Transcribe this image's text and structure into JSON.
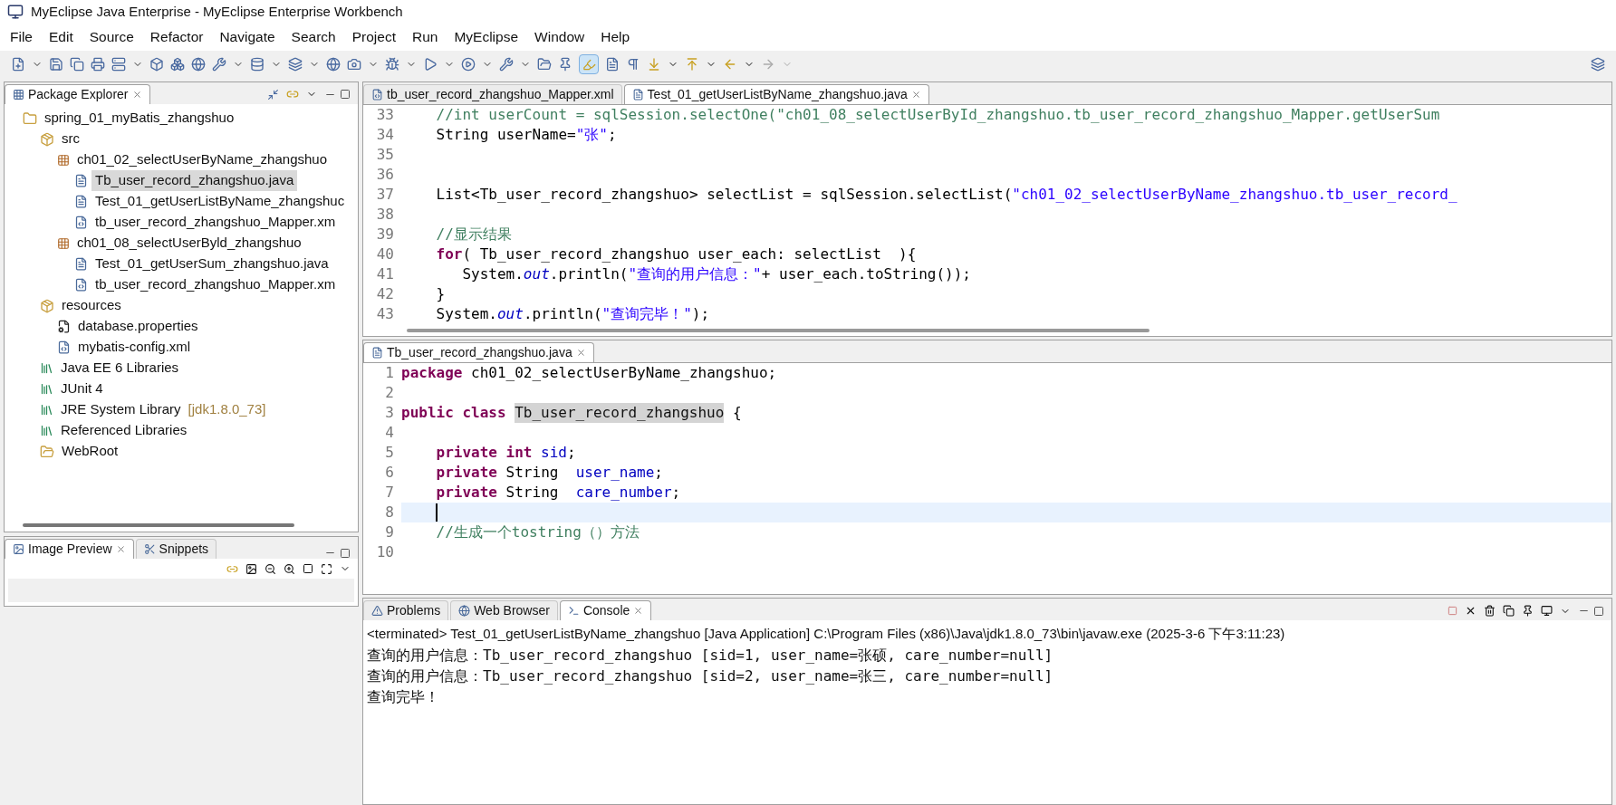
{
  "window": {
    "title": "MyEclipse Java Enterprise - MyEclipse Enterprise Workbench"
  },
  "menu": [
    "File",
    "Edit",
    "Source",
    "Refactor",
    "Navigate",
    "Search",
    "Project",
    "Run",
    "MyEclipse",
    "Window",
    "Help"
  ],
  "toolbar": {
    "highlight_toggle": {
      "pressed": true
    }
  },
  "package_explorer": {
    "tab": {
      "label": "Package Explorer",
      "selected": true
    },
    "tree": [
      {
        "label": "spring_01_myBatis_zhangshuo",
        "kind": "project",
        "selected": false,
        "children": [
          {
            "label": "src",
            "kind": "sourcefolder",
            "selected": false,
            "children": [
              {
                "label": "ch01_02_selectUserByName_zhangshuo",
                "kind": "package",
                "selected": false,
                "children": [
                  {
                    "label": "Tb_user_record_zhangshuo.java",
                    "kind": "java",
                    "selected": true
                  },
                  {
                    "label": "Test_01_getUserListByName_zhangshuc",
                    "kind": "java",
                    "selected": false
                  },
                  {
                    "label": "tb_user_record_zhangshuo_Mapper.xm",
                    "kind": "xml",
                    "selected": false
                  }
                ]
              },
              {
                "label": "ch01_08_selectUserByld_zhangshuo",
                "kind": "package",
                "selected": false,
                "children": [
                  {
                    "label": "Test_01_getUserSum_zhangshuo.java",
                    "kind": "java",
                    "selected": false
                  },
                  {
                    "label": "tb_user_record_zhangshuo_Mapper.xm",
                    "kind": "xml",
                    "selected": false
                  }
                ]
              }
            ]
          },
          {
            "label": "resources",
            "kind": "sourcefolder",
            "selected": false,
            "children": [
              {
                "label": "database.properties",
                "kind": "properties",
                "selected": false
              },
              {
                "label": "mybatis-config.xml",
                "kind": "xml",
                "selected": false
              }
            ]
          },
          {
            "label": "Java EE 6 Libraries",
            "kind": "library",
            "selected": false
          },
          {
            "label": "JUnit 4",
            "kind": "library",
            "selected": false
          },
          {
            "label": "JRE System Library",
            "decoration": "[jdk1.8.0_73]",
            "kind": "library",
            "selected": false
          },
          {
            "label": "Referenced Libraries",
            "kind": "library",
            "selected": false
          },
          {
            "label": "WebRoot",
            "kind": "folder",
            "selected": false
          }
        ]
      }
    ]
  },
  "preview_panel": {
    "tabs": [
      {
        "label": "Image Preview",
        "selected": true
      },
      {
        "label": "Snippets",
        "selected": false
      }
    ]
  },
  "editor_top": {
    "tabs": [
      {
        "label": "tb_user_record_zhangshuo_Mapper.xml",
        "kind": "xml",
        "selected": false
      },
      {
        "label": "Test_01_getUserListByName_zhangshuo.java",
        "kind": "java",
        "selected": true
      }
    ],
    "lines": [
      {
        "number": "33",
        "current": false,
        "tokens": [
          {
            "kind": "comment",
            "text": "    //int userCount = sqlSession.selectOne(\"ch01_08_selectUserById_zhangshuo.tb_user_record_zhangshuo_Mapper.getUserSum"
          }
        ]
      },
      {
        "number": "34",
        "current": false,
        "tokens": [
          {
            "kind": "plain",
            "text": "    String userName="
          },
          {
            "kind": "string",
            "text": "\"张\""
          },
          {
            "kind": "plain",
            "text": ";"
          }
        ]
      },
      {
        "number": "35",
        "current": false
      },
      {
        "number": "36",
        "current": false
      },
      {
        "number": "37",
        "current": false,
        "tokens": [
          {
            "kind": "plain",
            "text": "    List<Tb_user_record_zhangshuo> selectList = sqlSession.selectList("
          },
          {
            "kind": "string",
            "text": "\"ch01_02_selectUserByName_zhangshuo.tb_user_record_"
          }
        ]
      },
      {
        "number": "38",
        "current": false
      },
      {
        "number": "39",
        "current": false,
        "tokens": [
          {
            "kind": "comment",
            "text": "    //显示结果"
          }
        ]
      },
      {
        "number": "40",
        "current": false,
        "tokens": [
          {
            "kind": "keyword",
            "text": "    for"
          },
          {
            "kind": "plain",
            "text": "( Tb_user_record_zhangshuo user_each: selectList  ){"
          }
        ]
      },
      {
        "number": "41",
        "current": false,
        "tokens": [
          {
            "kind": "plain",
            "text": "       System."
          },
          {
            "kind": "static",
            "text": "out"
          },
          {
            "kind": "plain",
            "text": ".println("
          },
          {
            "kind": "string",
            "text": "\"查询的用户信息：\""
          },
          {
            "kind": "plain",
            "text": "+ user_each.toString());"
          }
        ]
      },
      {
        "number": "42",
        "current": false,
        "tokens": [
          {
            "kind": "plain",
            "text": "    }"
          }
        ]
      },
      {
        "number": "43",
        "current": false,
        "tokens": [
          {
            "kind": "plain",
            "text": "    System."
          },
          {
            "kind": "static",
            "text": "out"
          },
          {
            "kind": "plain",
            "text": ".println("
          },
          {
            "kind": "string",
            "text": "\"查询完毕！\""
          },
          {
            "kind": "plain",
            "text": ");"
          }
        ]
      }
    ]
  },
  "editor_bottom": {
    "tabs": [
      {
        "label": "Tb_user_record_zhangshuo.java",
        "kind": "java",
        "selected": true
      }
    ],
    "lines": [
      {
        "number": "1",
        "current": false,
        "tokens": [
          {
            "kind": "keyword",
            "text": "package"
          },
          {
            "kind": "plain",
            "text": " ch01_02_selectUserByName_zhangshuo;"
          }
        ]
      },
      {
        "number": "2",
        "current": false
      },
      {
        "number": "3",
        "current": false,
        "tokens": [
          {
            "kind": "keyword",
            "text": "public class"
          },
          {
            "kind": "occurrence",
            "text": "Tb_user_record_zhangshuo"
          },
          {
            "kind": "plain",
            "text": " {"
          }
        ]
      },
      {
        "number": "4",
        "current": false
      },
      {
        "number": "5",
        "current": false,
        "tokens": [
          {
            "kind": "keyword",
            "text": "    private int"
          },
          {
            "kind": "field",
            "text": "sid"
          },
          {
            "kind": "plain",
            "text": ";"
          }
        ]
      },
      {
        "number": "6",
        "current": false,
        "tokens": [
          {
            "kind": "keyword",
            "text": "    private"
          },
          {
            "kind": "plain",
            "text": " String "
          },
          {
            "kind": "field",
            "text": "user_name"
          },
          {
            "kind": "plain",
            "text": ";"
          }
        ]
      },
      {
        "number": "7",
        "current": false,
        "tokens": [
          {
            "kind": "keyword",
            "text": "    private"
          },
          {
            "kind": "plain",
            "text": " String "
          },
          {
            "kind": "field",
            "text": "care_number"
          },
          {
            "kind": "plain",
            "text": ";"
          }
        ]
      },
      {
        "number": "8",
        "current": true
      },
      {
        "number": "9",
        "current": false,
        "tokens": [
          {
            "kind": "comment",
            "text": "    //生成一个tostring（）方法"
          }
        ]
      },
      {
        "number": "10",
        "current": false
      }
    ]
  },
  "console_panel": {
    "tabs": [
      {
        "label": "Problems",
        "selected": false
      },
      {
        "label": "Web Browser",
        "selected": false
      },
      {
        "label": "Console",
        "selected": true
      }
    ],
    "header": "<terminated> Test_01_getUserListByName_zhangshuo [Java Application] C:\\Program Files (x86)\\Java\\jdk1.8.0_73\\bin\\javaw.exe (2025-3-6 下午3:11:23)",
    "output": [
      "查询的用户信息：Tb_user_record_zhangshuo [sid=1, user_name=张硕, care_number=null]",
      "查询的用户信息：Tb_user_record_zhangshuo [sid=2, user_name=张三, care_number=null]",
      "查询完毕！"
    ]
  }
}
